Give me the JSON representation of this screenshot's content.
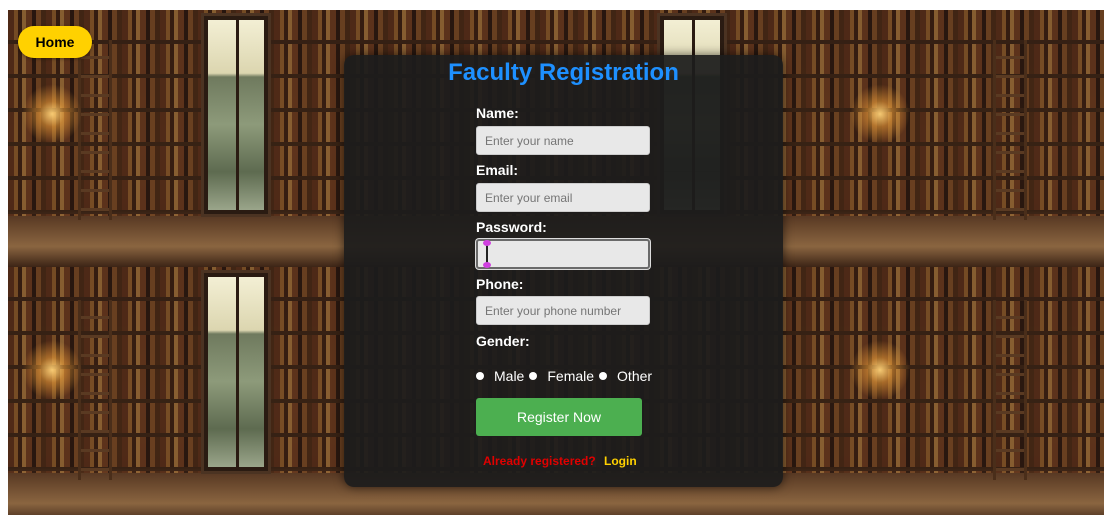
{
  "nav": {
    "home_label": "Home"
  },
  "form": {
    "title": "Faculty Registration",
    "name": {
      "label": "Name:",
      "placeholder": "Enter your name",
      "value": ""
    },
    "email": {
      "label": "Email:",
      "placeholder": "Enter your email",
      "value": ""
    },
    "password": {
      "label": "Password:",
      "placeholder": "",
      "value": ""
    },
    "phone": {
      "label": "Phone:",
      "placeholder": "Enter your phone number",
      "value": ""
    },
    "gender": {
      "label": "Gender:",
      "options": [
        "Male",
        "Female",
        "Other"
      ]
    },
    "submit_label": "Register Now",
    "already_text": "Already registered?",
    "login_label": "Login"
  },
  "colors": {
    "title": "#1e90ff",
    "home_button": "#ffd100",
    "register_button": "#4caf50",
    "already_text": "#e00000",
    "login_link": "#ffd100"
  }
}
